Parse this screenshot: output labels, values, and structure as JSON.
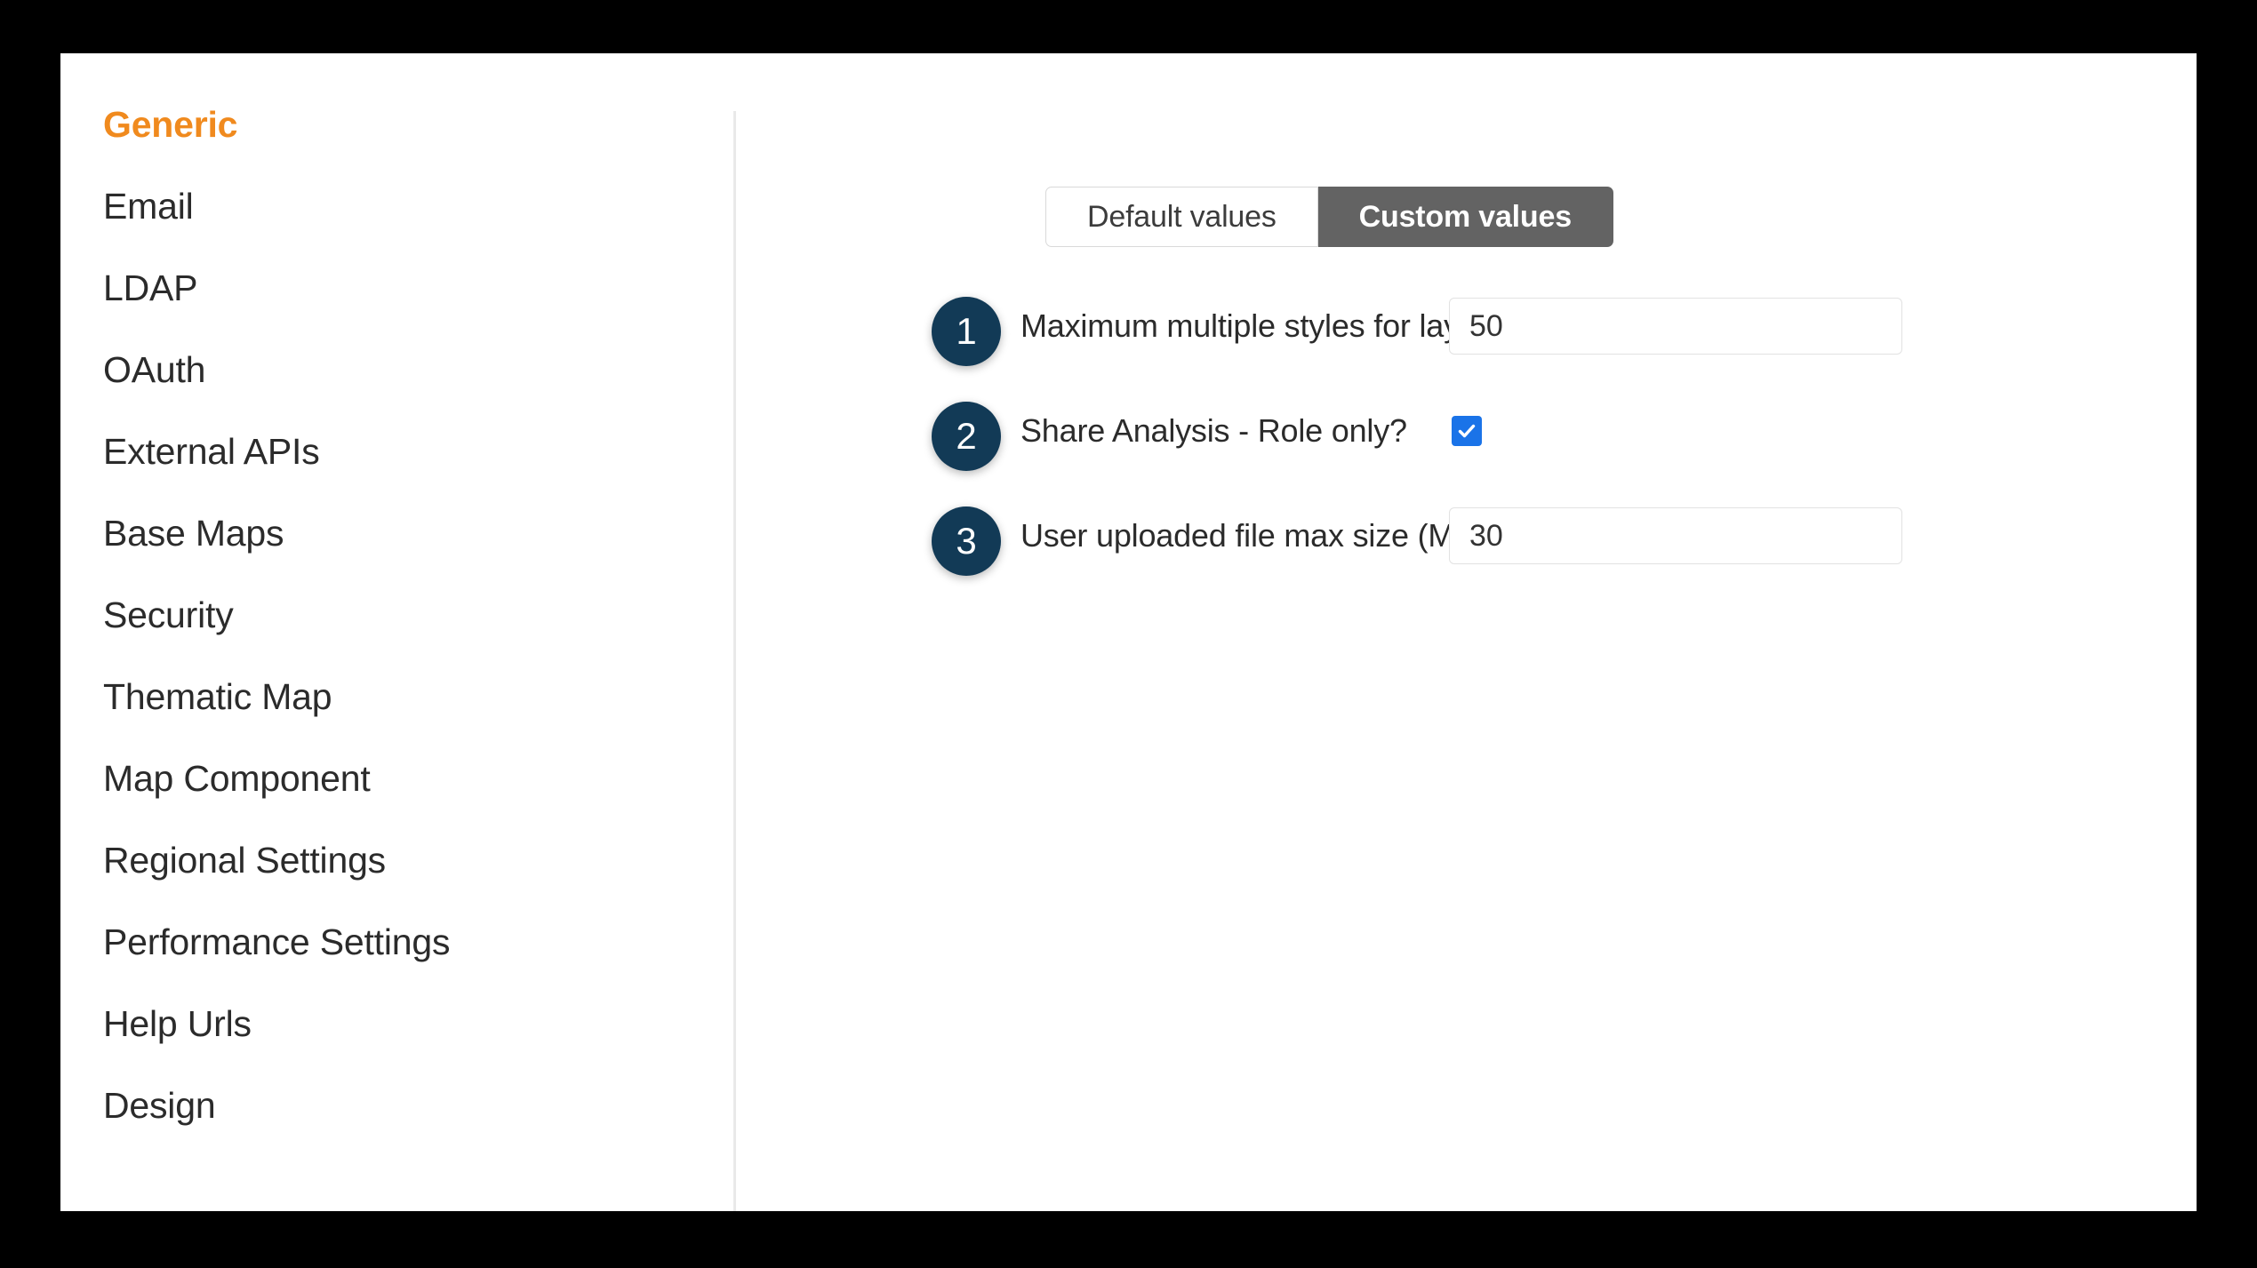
{
  "sidebar": {
    "items": [
      {
        "label": "Generic",
        "active": true
      },
      {
        "label": "Email",
        "active": false
      },
      {
        "label": "LDAP",
        "active": false
      },
      {
        "label": "OAuth",
        "active": false
      },
      {
        "label": "External APIs",
        "active": false
      },
      {
        "label": "Base Maps",
        "active": false
      },
      {
        "label": "Security",
        "active": false
      },
      {
        "label": "Thematic Map",
        "active": false
      },
      {
        "label": "Map Component",
        "active": false
      },
      {
        "label": "Regional Settings",
        "active": false
      },
      {
        "label": "Performance Settings",
        "active": false
      },
      {
        "label": "Help Urls",
        "active": false
      },
      {
        "label": "Design",
        "active": false
      }
    ]
  },
  "tabs": {
    "default_values_label": "Default values",
    "custom_values_label": "Custom values",
    "selected": "Custom values"
  },
  "settings": {
    "rows": [
      {
        "badge": "1",
        "label": "Maximum multiple styles for layer",
        "type": "text",
        "value": "50"
      },
      {
        "badge": "2",
        "label": "Share Analysis - Role only?",
        "type": "checkbox",
        "checked": true
      },
      {
        "badge": "3",
        "label": "User uploaded file max size (MB)",
        "type": "text",
        "value": "30"
      }
    ]
  },
  "colors": {
    "accent_orange": "#f08a1e",
    "badge_navy": "#123a56",
    "selected_tab_gray": "#636363",
    "checkbox_blue": "#1a73e8",
    "backdrop": "#000000"
  }
}
